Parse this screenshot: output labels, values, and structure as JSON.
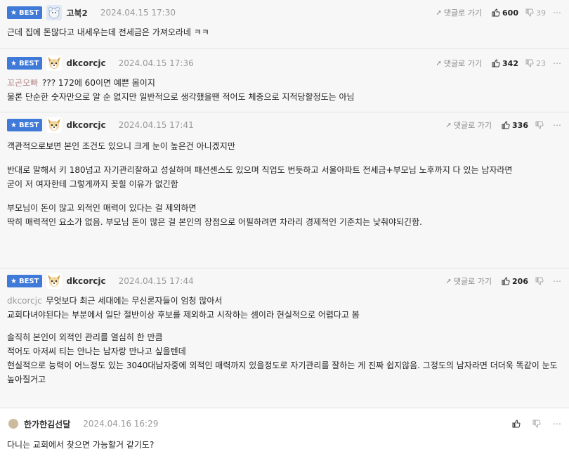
{
  "labels": {
    "best": "BEST",
    "reply": "댓글로 가기"
  },
  "comments": [
    {
      "type": "best",
      "nick": "고북2",
      "date": "2024.04.15 17:30",
      "likes": "600",
      "dislikes": "39",
      "lines": [
        "근데 집에 돈많다고 내세우는데 전세금은 가져오라네 ㅋㅋ"
      ]
    },
    {
      "type": "best",
      "nick": "dkcorcjc",
      "date": "2024.04.15 17:36",
      "likes": "342",
      "dislikes": "23",
      "mention": "꼬곤오빠",
      "lines": [
        "??? 172에 60이면 예쁜 몸이지",
        "물론 단순한 숫자만으로 알 순 없지만 일반적으로 생각했을땐 적어도 체중으로 지적당할정도는 아님"
      ]
    },
    {
      "type": "best",
      "nick": "dkcorcjc",
      "date": "2024.04.15 17:41",
      "likes": "336",
      "dislikes": "",
      "lines": [
        "객관적으로보면 본인 조건도 있으니 크게 눈이 높은건 아니겠지만",
        "",
        "반대로 말해서 키 180넘고 자기관리잘하고 성실하며 패션센스도 있으며 직업도 번듯하고 서울아파트 전세금+부모님 노후까지 다 있는 남자라면",
        "굳이 저 여자한테 그렇게까지 꽂힐 이유가 없긴함",
        "",
        "부모님이 돈이 많고 외적인 매력이 있다는 걸 제외하면",
        "딱히 매력적인 요소가 없음. 부모님 돈이 많은 걸 본인의 장점으로 어필하려면 차라리 경제적인 기준치는 낮춰야되긴함."
      ]
    },
    {
      "type": "best",
      "nick": "dkcorcjc",
      "date": "2024.04.15 17:44",
      "likes": "206",
      "dislikes": "",
      "mention": "dkcorcjc",
      "lines": [
        "무엇보다 최근 세대에는 무신론자들이 엄청 많아서",
        "교회다녀야된다는 부분에서 일단 절반이상 후보를 제외하고 시작하는 셈이라 현실적으로 어렵다고 봄",
        "",
        "솔직히 본인이 외적인 관리를 열심히 한 만큼",
        "적어도 아저씨 티는 안나는 남자랑 만나고 싶을텐데",
        "현실적으로 능력이 어느정도 있는 3040대남자중에 외적인 매력까지 있을정도로 자기관리를 잘하는 게 진짜 쉽지않음. 그정도의 남자라면 더더욱 똑같이 눈도 높아질거고"
      ]
    },
    {
      "type": "normal",
      "nick": "한가한김선달",
      "date": "2024.04.16 16:29",
      "likes": "",
      "dislikes": "",
      "lines": [
        "다니는 교회에서 찾으면 가능할거 같기도?"
      ]
    }
  ]
}
